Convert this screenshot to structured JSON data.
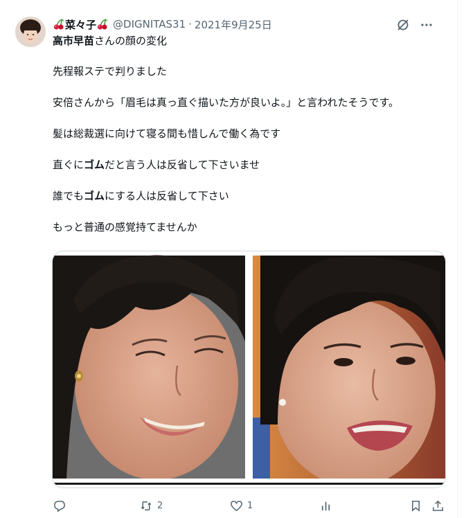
{
  "tweet": {
    "author": {
      "name": "菜々子",
      "handle": "@DIGNITAS31",
      "separator": "·",
      "date": "2021年9月25日"
    },
    "title": {
      "bold_part": "高市早苗",
      "rest": "さんの顔の変化"
    },
    "paragraphs": [
      "先程報ステで判りました",
      "安倍さんから「眉毛は真っ直ぐ描いた方が良いよ。」と言われたそうです。",
      "髪は総裁選に向けて寝る間も惜しんで働く為です"
    ],
    "line_gomu1": {
      "before": "直ぐに",
      "bold": "ゴム",
      "after": "だと言う人は反省して下さいませ"
    },
    "line_gomu2": {
      "before": "誰でも",
      "bold": "ゴム",
      "after": "にする人は反省して下さい"
    },
    "closing": "もっと普通の感覚持てませんか",
    "stats": {
      "retweets": "2",
      "likes": "1"
    },
    "icons": [
      "cherry-icon",
      "grok-icon",
      "more-icon",
      "reply-icon",
      "retweet-icon",
      "like-icon",
      "views-icon",
      "bookmark-icon",
      "share-icon"
    ]
  },
  "colors": {
    "text": "#0f1419",
    "secondary": "#536471",
    "border": "#cfd9de",
    "cherry": "#d81b3c"
  }
}
